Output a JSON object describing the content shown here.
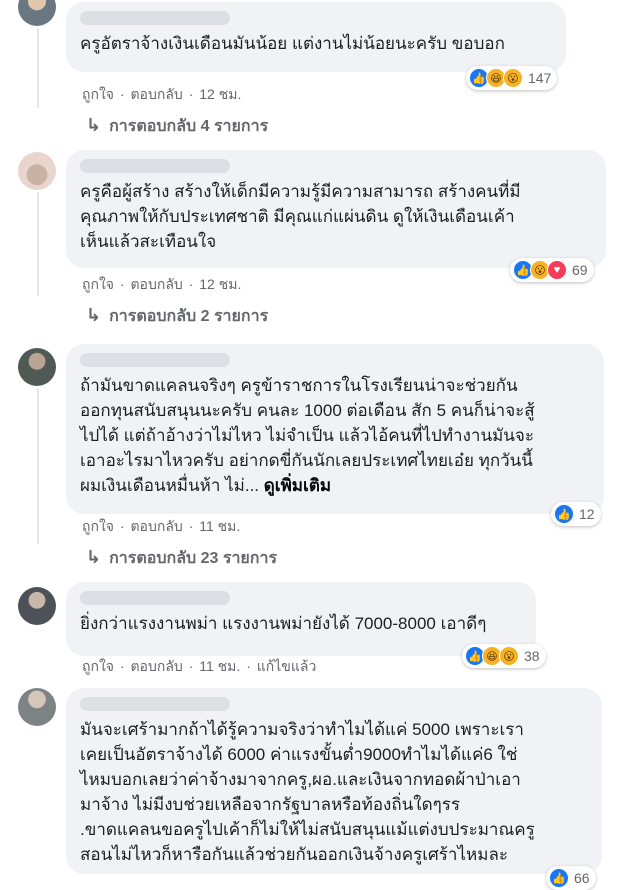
{
  "comments": [
    {
      "text": "ครูอัตราจ้างเงินเดือนมันน้อย แต่งานไม่น้อยนะครับ ขอบอก",
      "like": "ถูกใจ",
      "reply": "ตอบกลับ",
      "time": "12 ชม.",
      "reactions_count": "147",
      "replies": "การตอบกลับ 4 รายการ"
    },
    {
      "text": "ครูคือผู้สร้าง สร้างให้เด็กมีความรู้มีความสามารถ สร้างคนที่มี\nคุณภาพให้กับประเทศชาติ มีคุณแก่แผ่นดิน ดูให้เงินเดือนเค้า\nเห็นแล้วสะเทือนใจ",
      "like": "ถูกใจ",
      "reply": "ตอบกลับ",
      "time": "12 ชม.",
      "reactions_count": "69",
      "replies": "การตอบกลับ 2 รายการ"
    },
    {
      "text": "ถ้ามันขาดแคลนจริงๆ ครูข้าราชการในโรงเรียนน่าจะช่วยกัน\nออกทุนสนับสนุนนะครับ คนละ 1000 ต่อเดือน สัก 5 คนก็น่าจะสู้\nไปได้ แต่ถ้าอ้างว่าไม่ไหว ไม่จำเป็น แล้วไอ้คนที่ไปทำงานมันจะ\nเอาอะไรมาไหวครับ อย่ากดขี่กันนักเลยประเทศไทยเอ๋ย ทุกวันนี้\nผมเงินเดือนหมื่นห้า ไม่...",
      "see_more": "ดูเพิ่มเติม",
      "like": "ถูกใจ",
      "reply": "ตอบกลับ",
      "time": "11 ชม.",
      "reactions_count": "12",
      "replies": "การตอบกลับ 23 รายการ"
    },
    {
      "text": "ยิ่งกว่าแรงงานพม่า แรงงานพม่ายังได้ 7000-8000 เอาดีๆ",
      "like": "ถูกใจ",
      "reply": "ตอบกลับ",
      "time": "11 ชม.",
      "edited": "แก้ไขแล้ว",
      "reactions_count": "38"
    },
    {
      "text": "มันจะเศร้ามากถ้าได้รู้ความจริงว่าทำไมได้แค่ 5000 เพราะเรา\nเคยเป็นอัตราจ้างได้ 6000 ค่าแรงขั้นต่ำ9000ทำไมได้แค่6 ใช่\nไหมบอกเลยว่าค่าจ้างมาจากครู,ผอ.และเงินจากทอดผ้าป่าเอา\nมาจ้าง ไม่มีงบช่วยเหลือจากรัฐบาลหรือท้องถิ่นใดๆรร\n.ขาดแคลนขอครูไปเค้าก็ไม่ให้ไม่สนับสนุนแม้แต่งบประมาณครู\nสอนไม่ไหวก็หารือกันแล้วช่วยกันออกเงินจ้างครูเศร้าไหมละ",
      "reactions_count": "66"
    }
  ],
  "separator": "·",
  "reply_arrow": "↳",
  "icons": {
    "like": "like-reaction-icon",
    "haha": "haha-reaction-icon",
    "wow": "wow-reaction-icon",
    "love": "love-reaction-icon"
  },
  "colors": {
    "bubble": "#f0f2f5",
    "meta": "#65676b",
    "like": "#1877f2"
  }
}
